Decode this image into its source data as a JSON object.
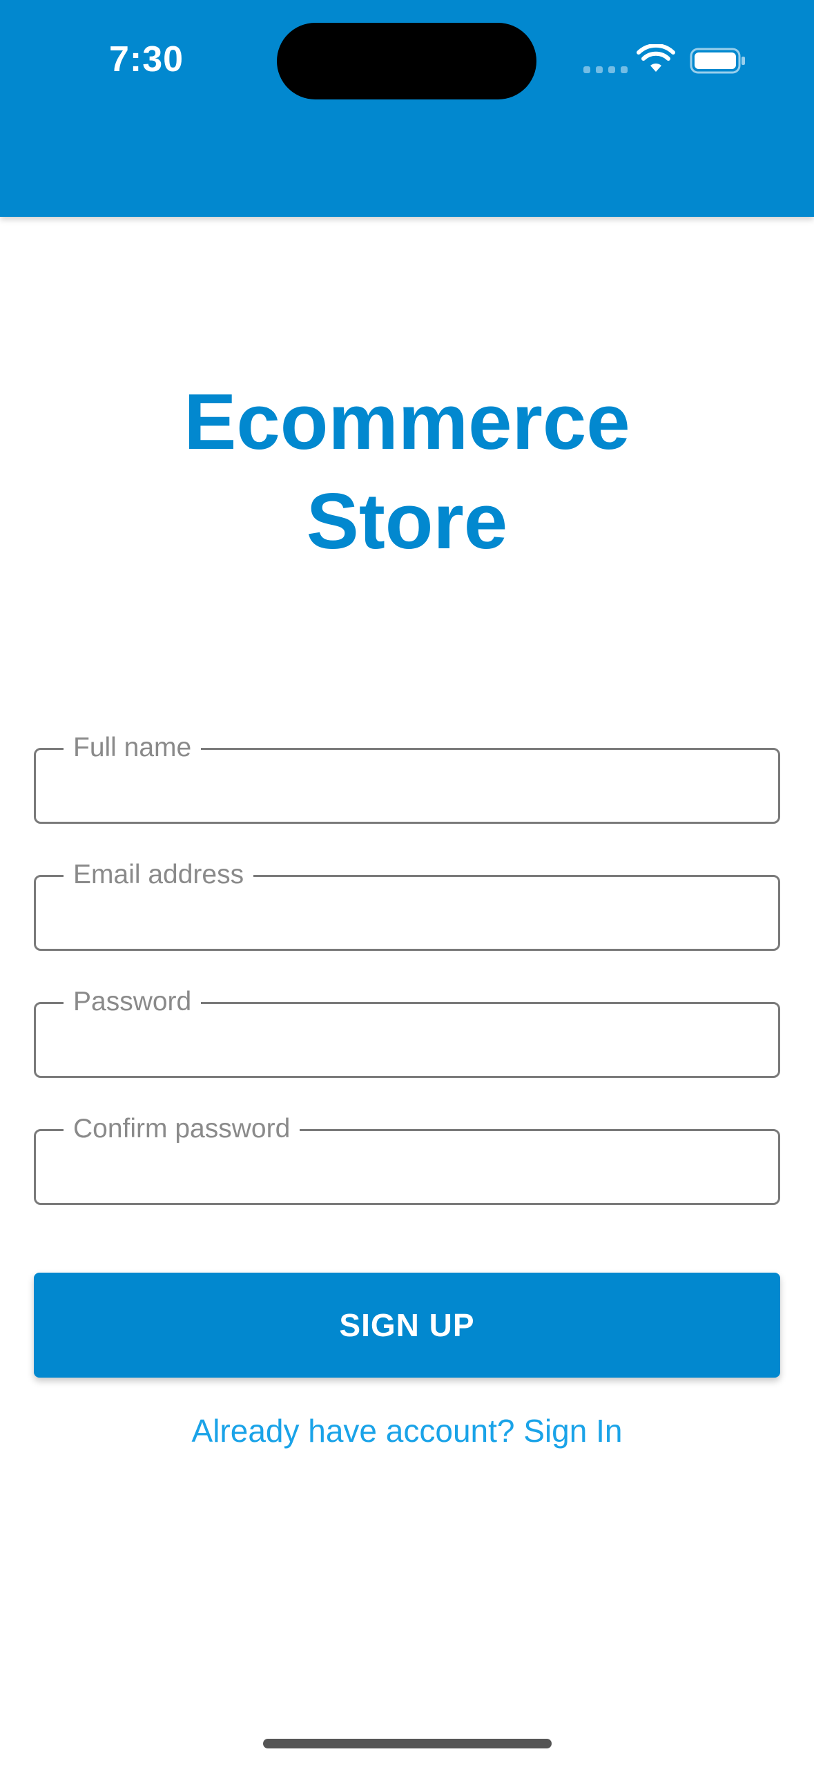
{
  "status_bar": {
    "time": "7:30"
  },
  "title": {
    "line1": "Ecommerce",
    "line2": "Store"
  },
  "form": {
    "fields": [
      {
        "label": "Full name",
        "value": ""
      },
      {
        "label": "Email address",
        "value": ""
      },
      {
        "label": "Password",
        "value": ""
      },
      {
        "label": "Confirm password",
        "value": ""
      }
    ],
    "submit_label": "SIGN UP",
    "signin_link": "Already have account? Sign In"
  },
  "colors": {
    "primary": "#0288cf",
    "link": "#1aa3e8",
    "field_border": "#7a7a7a",
    "label": "#8a8a8a"
  },
  "icons": [
    "signal-icon",
    "wifi-icon",
    "battery-icon"
  ]
}
